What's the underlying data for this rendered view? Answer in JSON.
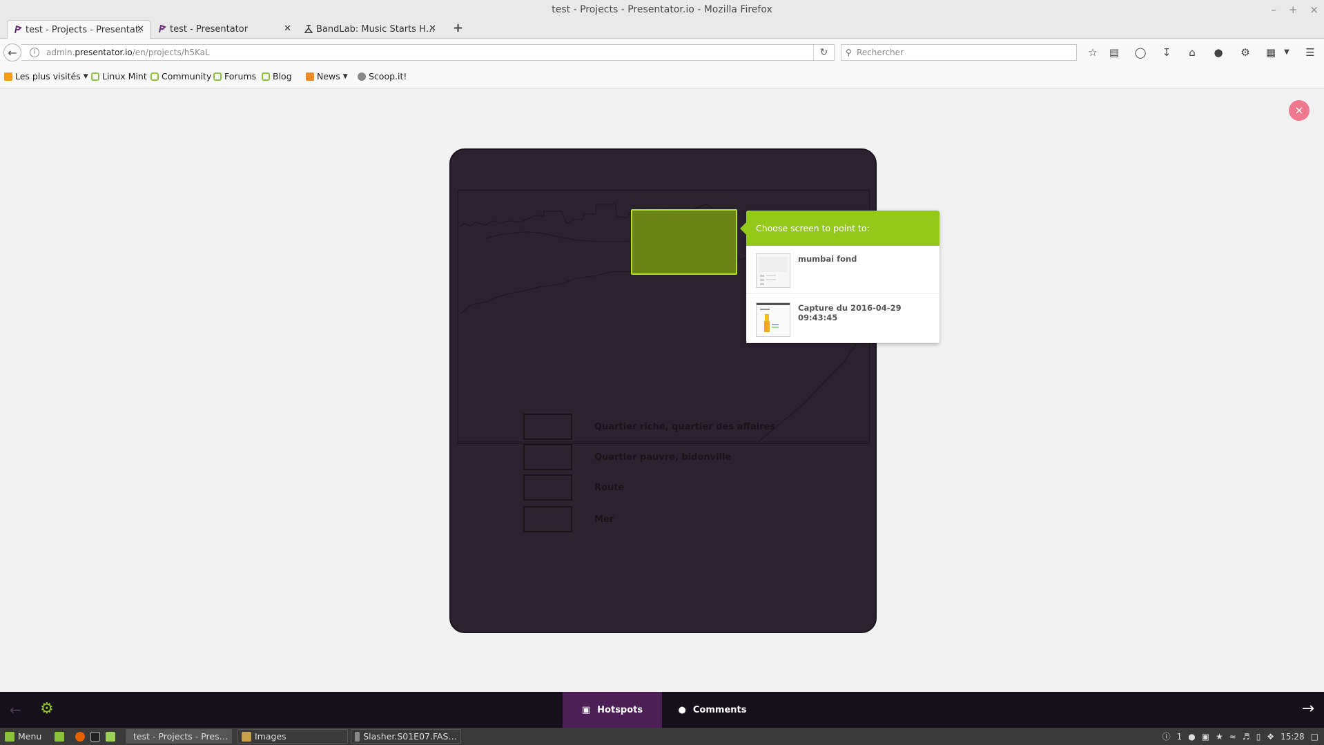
{
  "window": {
    "title": "test - Projects - Presentator.io - Mozilla Firefox",
    "controls": [
      "–",
      "+",
      "×"
    ]
  },
  "tabs": [
    {
      "label": "test - Projects - Presentat…",
      "active": true
    },
    {
      "label": "test - Presentator",
      "active": false
    },
    {
      "label": "BandLab: Music Starts H…",
      "active": false
    }
  ],
  "tab_close_glyph": "✕",
  "new_tab_glyph": "+",
  "navbar": {
    "url_prefix": "admin.",
    "url_host": "presentator.io",
    "url_path": "/en/projects/h5KaL",
    "search_placeholder": "Rechercher",
    "icons": [
      "star-icon",
      "reading-list-icon",
      "pocket-icon",
      "download-icon",
      "home-icon",
      "chat-icon",
      "extension-icon",
      "clipboard-icon",
      "menu-icon"
    ]
  },
  "bookmarks": [
    {
      "label": "Les plus visités",
      "icon": "folder-icon",
      "dropdown": true
    },
    {
      "label": "Linux Mint",
      "icon": "mint-icon"
    },
    {
      "label": "Community",
      "icon": "mint-icon"
    },
    {
      "label": "Forums",
      "icon": "mint-icon"
    },
    {
      "label": "Blog",
      "icon": "mint-icon"
    },
    {
      "label": "News",
      "icon": "rss-icon",
      "dropdown": true
    },
    {
      "label": "Scoop.it!",
      "icon": "scoop-icon"
    }
  ],
  "preview": {
    "close_glyph": "×",
    "legend": [
      {
        "label": "Quartier riche, quartier des affaires"
      },
      {
        "label": "Quartier pauvre, bidonville"
      },
      {
        "label": "Route"
      },
      {
        "label": "Mer"
      }
    ]
  },
  "popover": {
    "title": "Choose screen to point to:",
    "screens": [
      {
        "name": "mumbai fond"
      },
      {
        "name": "Capture du 2016-04-29 09:43:45"
      }
    ]
  },
  "bottom_bar": {
    "hotspots_label": "Hotspots",
    "comments_label": "Comments",
    "accent": "#94c91a",
    "active_tab_color": "#4c1f57"
  },
  "taskbar": {
    "menu_label": "Menu",
    "windows": [
      {
        "label": "test - Projects - Pres…",
        "active": true
      },
      {
        "label": "Images",
        "active": false
      },
      {
        "label": "Slasher.S01E07.FAS…",
        "active": false
      }
    ],
    "workspace": "1",
    "clock": "15:28"
  }
}
